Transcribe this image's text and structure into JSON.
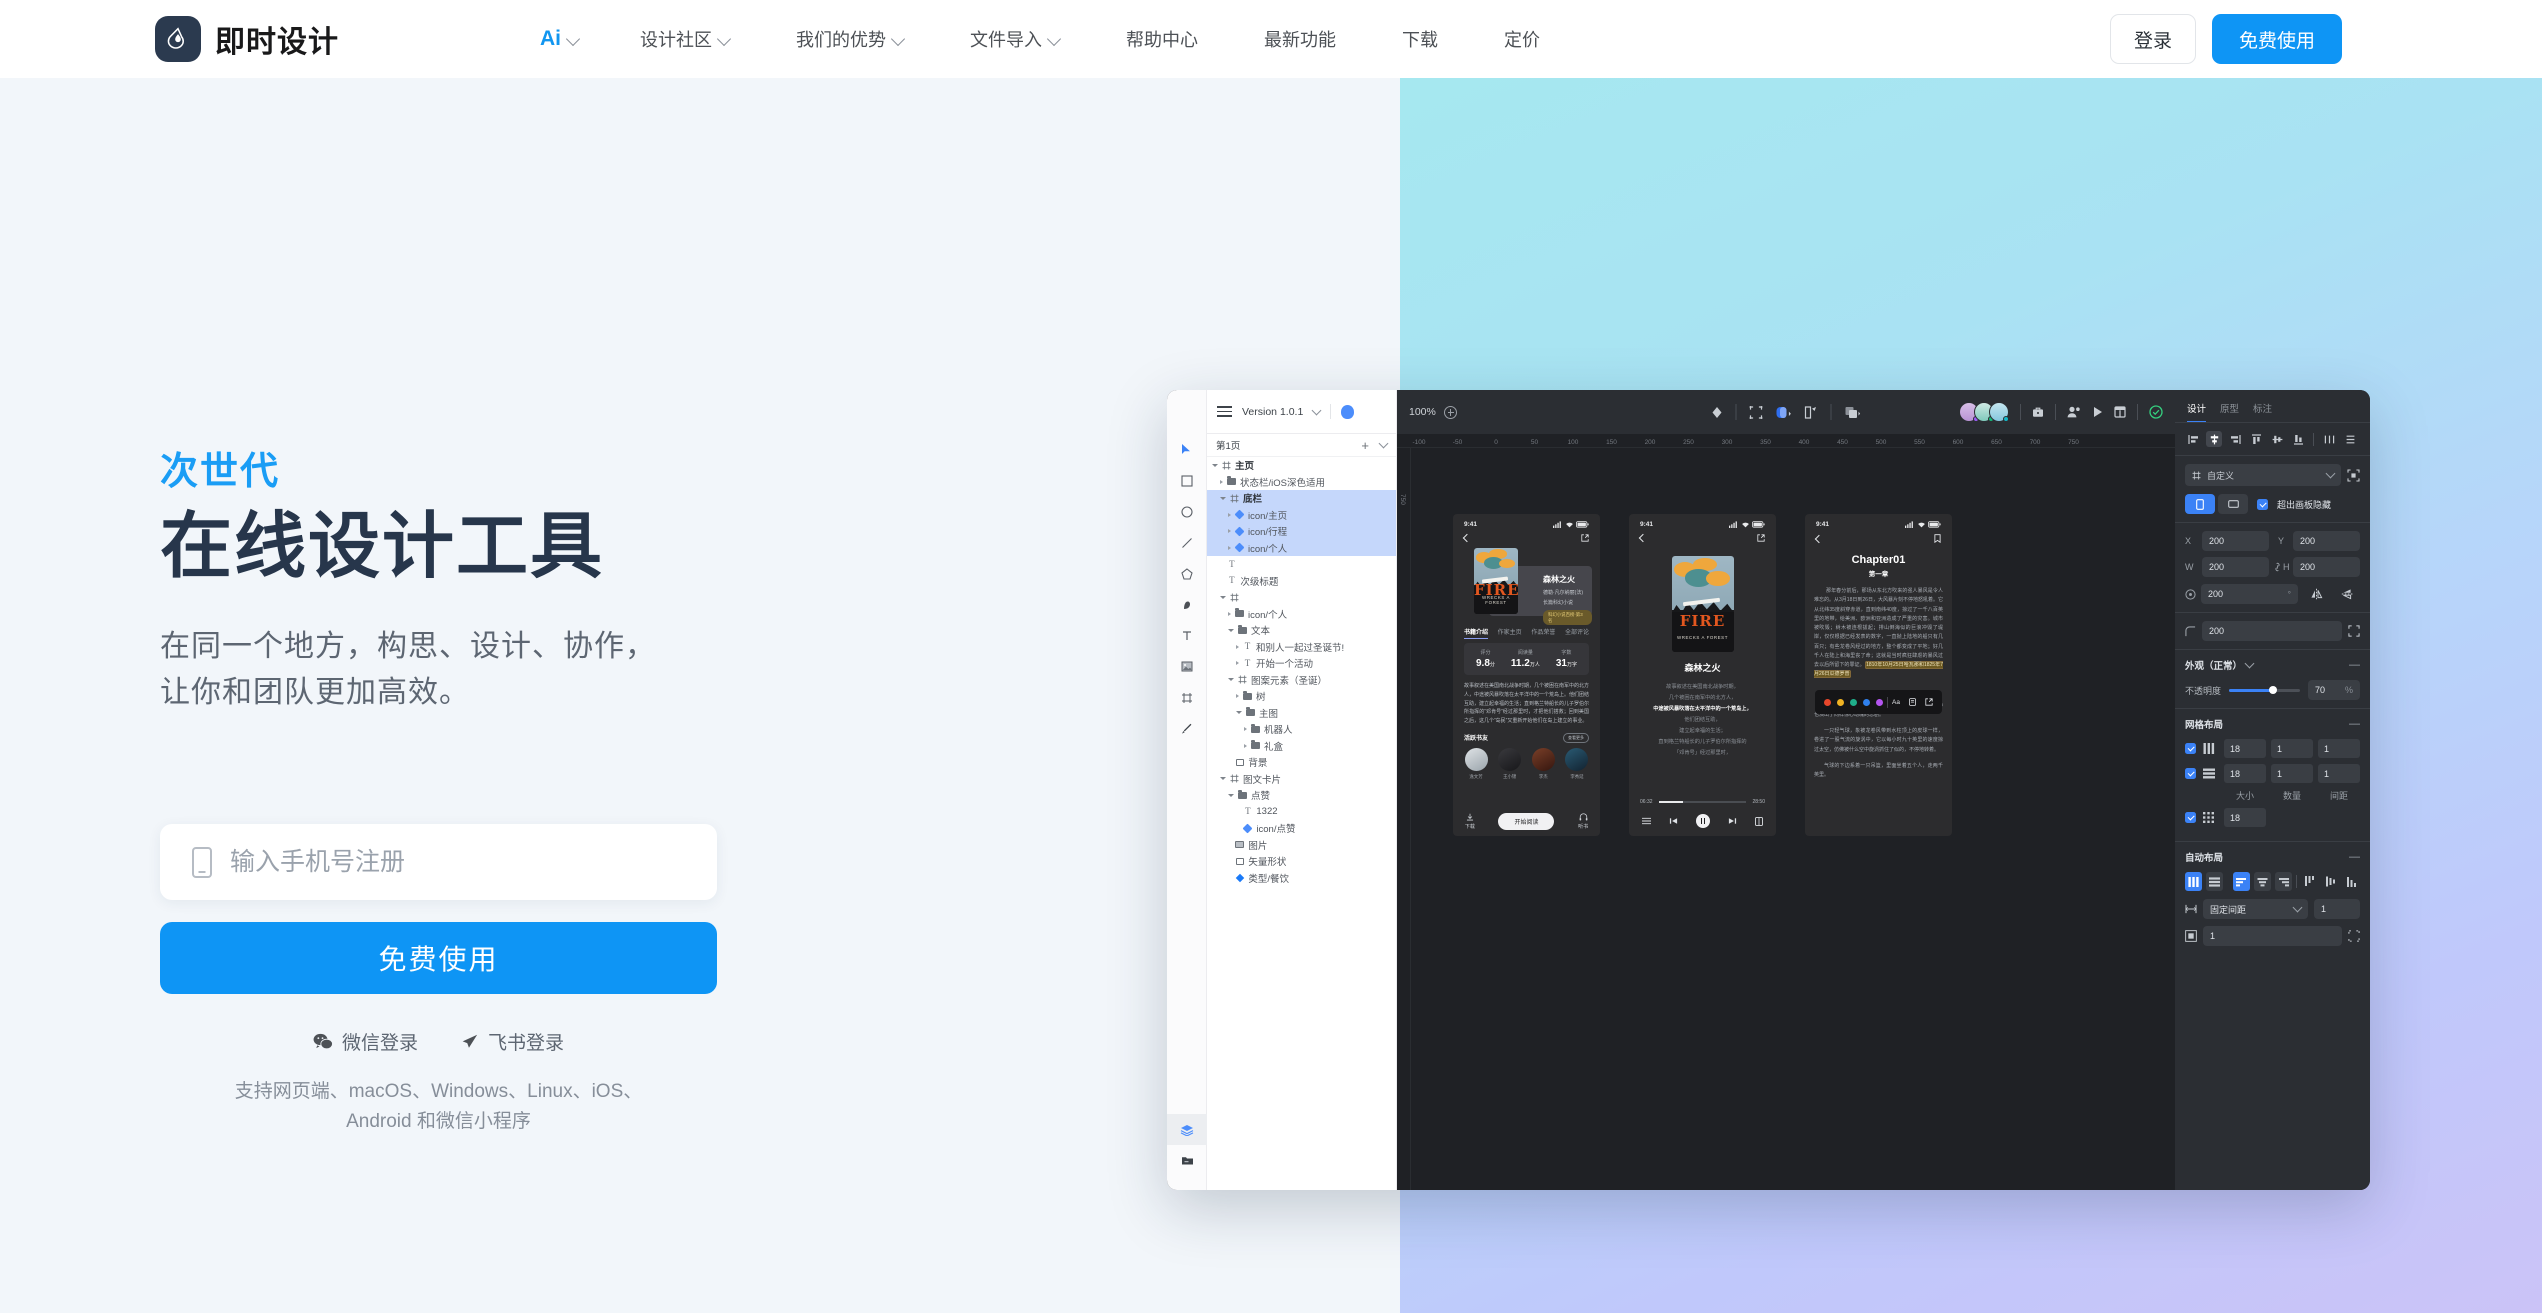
{
  "nav": {
    "brand": "即时设计",
    "brand_logo_icon": "droplet-logo-icon",
    "menu": [
      {
        "label": "Ai",
        "caret": true,
        "accent": true
      },
      {
        "label": "设计社区",
        "caret": true
      },
      {
        "label": "我们的优势",
        "caret": true
      },
      {
        "label": "文件导入",
        "caret": true
      },
      {
        "label": "帮助中心",
        "caret": false
      },
      {
        "label": "最新功能",
        "caret": false
      },
      {
        "label": "下载",
        "caret": false
      },
      {
        "label": "定价",
        "caret": false
      }
    ],
    "login_label": "登录",
    "free_label": "免费使用"
  },
  "hero": {
    "eyebrow": "次世代",
    "headline": "在线设计工具",
    "subhead_line1": "在同一个地方，构思、设计、协作，",
    "subhead_line2": "让你和团队更加高效。",
    "phone_placeholder": "输入手机号注册",
    "cta_label": "免费使用",
    "social": [
      {
        "label": "微信登录",
        "icon": "wechat-icon"
      },
      {
        "label": "飞书登录",
        "icon": "feishu-icon"
      }
    ],
    "support_line1": "支持网页端、macOS、Windows、Linux、iOS、",
    "support_line2": "Android 和微信小程序",
    "accent_color": "#0e95f5",
    "headline_color": "#27364b"
  },
  "app": {
    "titlebar": {
      "menu_icon": "hamburger-icon",
      "version": "Version 1.0.1",
      "avatar_icon": "user-avatar-icon"
    },
    "tools": [
      {
        "icon": "cursor-icon",
        "active": true
      },
      {
        "icon": "rectangle-icon"
      },
      {
        "icon": "ellipse-icon"
      },
      {
        "icon": "line-icon"
      },
      {
        "icon": "polygon-icon"
      },
      {
        "icon": "pen-icon"
      },
      {
        "icon": "text-icon"
      },
      {
        "icon": "image-icon"
      },
      {
        "icon": "frame-icon"
      },
      {
        "icon": "brush-icon"
      }
    ],
    "tools_bottom": [
      {
        "icon": "layers-icon",
        "selected": true
      },
      {
        "icon": "assets-folder-icon"
      }
    ],
    "layers": {
      "page_label": "第1页",
      "add_icon": "plus-icon",
      "collapse_icon": "chevron-down-icon",
      "tree": [
        {
          "label": "主页",
          "depth": 0,
          "icon": "frame-icon",
          "twist": "open",
          "bold": true
        },
        {
          "label": "状态栏/iOS深色适用",
          "depth": 1,
          "icon": "folder-icon",
          "twist": "closed"
        },
        {
          "label": "底栏",
          "depth": 1,
          "icon": "frame-icon",
          "twist": "open",
          "selected": true,
          "bold": true
        },
        {
          "label": "icon/主页",
          "depth": 2,
          "icon": "component-icon",
          "twist": "closed",
          "selected": true
        },
        {
          "label": "icon/行程",
          "depth": 2,
          "icon": "component-icon",
          "twist": "closed",
          "selected": true
        },
        {
          "label": "icon/个人",
          "depth": 2,
          "icon": "component-icon",
          "twist": "closed",
          "selected": true
        },
        {
          "label": "",
          "depth": 1,
          "icon": "text-icon",
          "twist": "none"
        },
        {
          "label": "次级标题",
          "depth": 1,
          "icon": "text-icon",
          "twist": "none"
        },
        {
          "label": "",
          "depth": 1,
          "icon": "frame-icon",
          "twist": "open"
        },
        {
          "label": "icon/个人",
          "depth": 2,
          "icon": "folder-icon",
          "twist": "closed"
        },
        {
          "label": "文本",
          "depth": 2,
          "icon": "folder-icon",
          "twist": "open"
        },
        {
          "label": "和别人一起过圣诞节!",
          "depth": 3,
          "icon": "text-icon",
          "twist": "closed"
        },
        {
          "label": "开始一个活动",
          "depth": 3,
          "icon": "text-icon",
          "twist": "closed"
        },
        {
          "label": "图案元素（圣诞）",
          "depth": 2,
          "icon": "frame-icon",
          "twist": "open"
        },
        {
          "label": "树",
          "depth": 3,
          "icon": "folder-icon",
          "twist": "closed"
        },
        {
          "label": "主图",
          "depth": 3,
          "icon": "folder-icon",
          "twist": "open"
        },
        {
          "label": "机器人",
          "depth": 4,
          "icon": "folder-icon",
          "twist": "closed"
        },
        {
          "label": "礼盒",
          "depth": 4,
          "icon": "folder-icon",
          "twist": "closed"
        },
        {
          "label": "背景",
          "depth": 2,
          "icon": "rect-icon",
          "twist": "none"
        },
        {
          "label": "图文卡片",
          "depth": 1,
          "icon": "frame-icon",
          "twist": "open"
        },
        {
          "label": "点赞",
          "depth": 2,
          "icon": "folder-icon",
          "twist": "open"
        },
        {
          "label": "1322",
          "depth": 3,
          "icon": "text-icon",
          "twist": "none"
        },
        {
          "label": "icon/点赞",
          "depth": 3,
          "icon": "component-icon",
          "twist": "none"
        },
        {
          "label": "图片",
          "depth": 2,
          "icon": "image-icon",
          "twist": "none"
        },
        {
          "label": "矢量形状",
          "depth": 2,
          "icon": "rect-icon",
          "twist": "none"
        },
        {
          "label": "类型/餐饮",
          "depth": 2,
          "icon": "instance-icon",
          "twist": "none"
        }
      ]
    },
    "toolbar": {
      "zoom": "100%",
      "zoom_plus_icon": "zoom-in-icon",
      "center_icons": [
        "diamond-icon",
        "scale-icon",
        "mask-icon",
        "component-split-icon",
        "boolean-icon"
      ],
      "right_icons": [
        "toolbox-icon",
        "invite-user-icon",
        "play-icon",
        "layout-icon",
        "check-circle-icon"
      ],
      "avatars": 3
    },
    "ruler": {
      "h_ticks": [
        "-100",
        "-50",
        "0",
        "50",
        "100",
        "150",
        "200",
        "250",
        "300",
        "350",
        "400",
        "450",
        "500",
        "550",
        "600",
        "650",
        "700",
        "750"
      ],
      "v_ticks": [
        "750"
      ]
    },
    "mockup1": {
      "time": "9:41",
      "back_icon": "chevron-left-icon",
      "share_icon": "share-icon",
      "title": "森林之火",
      "author": "德勒·凡尔纳丽(法)",
      "category": "长篇科幻小说",
      "badge": "科幻小说百榜·第3名",
      "cover_fire": "FIRE",
      "cover_sub": "WRECKS A FOREST",
      "tabs": [
        "书籍介绍",
        "作家主页",
        "作品荣誉",
        "全部评论"
      ],
      "stats": [
        {
          "label": "评分",
          "value": "9.8",
          "unit": "分"
        },
        {
          "label": "阅读量",
          "value": "11.2",
          "unit": "万人"
        },
        {
          "label": "字数",
          "value": "31",
          "unit": "万字"
        }
      ],
      "desc": "故事叙述在美国南北战争时期，几个被困在南军中的北方人，中途被风暴吹落在太平洋中的一个荒岛上。他们团结互助，建立起幸福的生活；直到格兰特船长的儿子罗伯尔所指挥的“邓肯号”经过那里时，才把他们搭救；回到美国之后，这几个“岛民”又重新开始他们在岛上建立的事业。",
      "friends_title": "活跃书友",
      "friends_more": "查看更多",
      "friends": [
        "逸文芳",
        "王小锦",
        "李杰",
        "李秀延"
      ],
      "bottom": [
        {
          "label": "下载",
          "icon": "download-icon"
        },
        {
          "label": "开始阅读",
          "icon": ""
        },
        {
          "label": "听书",
          "icon": "headphone-icon"
        }
      ]
    },
    "mockup2": {
      "time": "9:41",
      "title": "森林之火",
      "lines": [
        {
          "text": "故事叙述在美国南北战争时期，",
          "highlight": false
        },
        {
          "text": "几个被困在南军中的北方人，",
          "highlight": false
        },
        {
          "text": "中途被风暴吹落在太平洋中的一个荒岛上，",
          "highlight": true
        },
        {
          "text": "他们团结互助，",
          "highlight": false
        },
        {
          "text": "建立起幸福的生活；",
          "highlight": false
        },
        {
          "text": "直到格兰特船长的儿子罗伯尔所指挥的",
          "highlight": false
        },
        {
          "text": "「邓肯号」经过那里时，",
          "highlight": false
        }
      ],
      "time_elapsed": "06:32",
      "time_total": "28:50",
      "controls": [
        "list-icon",
        "prev-icon",
        "pause-icon",
        "next-icon",
        "book-icon"
      ]
    },
    "mockup3": {
      "time": "9:41",
      "back_icon": "chevron-left-icon",
      "bookmark_icon": "bookmark-icon",
      "chapter": "Chapter01",
      "chapter_cn": "第一章",
      "body_1": "那年春分前后，那场从东北方吹来的强人暴风是令人难忘的。从3月18日到26日，大风暴片刻不停地怒吼着。它从北纬35度斜穿赤道，直到南纬40度，掠过了一千八百英里的地带，给美洲、欧洲和亚洲造成了严重的灾害。城市被吹毁；树木被连根拔起；排山倒海似的巨浪冲毁了堤岸，仅仅根据已经发表的数字，一直抛上陆地的船只有几百只；有些龙卷风经过的地方，整个都变成了平地；好几千人在陆上和海里丧了命；这就是当时疯狂肆虐的暴风过去以后所留下的罪证。",
      "highlight_text": "1810年10月25日哈瓦那和1825年7月26日瓜德罗普",
      "body_2": "就在这陆地和海洋上惨遭浩劫的时候，激荡的高空中也演出了同样惊心动魄的悲剧。",
      "body_3": "一只轻气球，象被龙卷风带到水柱顶上的皮球一样，卷进了一股气流的旋涡中，它以每小时九十英里的速度掠过太空，仿佛被什么空中旋涡抓住了似的，不停地转着。",
      "body_4": "气球的下边系着一只吊篮，里面坐着五个人，走两千英里。",
      "ctx_swatches": [
        "#e8472b",
        "#f0b323",
        "#1fae8a",
        "#2f80ed",
        "#b455f0"
      ],
      "ctx_icons": [
        "text-size-icon",
        "note-icon",
        "share-icon"
      ]
    },
    "props": {
      "tabs": [
        {
          "label": "设计",
          "active": true
        },
        {
          "label": "原型",
          "active": false
        },
        {
          "label": "标注",
          "active": false
        }
      ],
      "align_icons": [
        "align-left-icon",
        "align-center-h-icon",
        "align-right-icon",
        "align-top-icon",
        "align-middle-v-icon",
        "align-bottom-icon",
        "distribute-h-icon",
        "distribute-v-icon"
      ],
      "constraint_label": "自定义",
      "constraint_icon": "frame-icon",
      "constraint_more_icon": "constraint-target-icon",
      "orientation_icons": [
        "portrait-icon",
        "landscape-icon"
      ],
      "clip_label": "超出画板隐藏",
      "clip_checked": true,
      "transform": {
        "x_label": "X",
        "x_value": "200",
        "y_label": "Y",
        "y_value": "200",
        "w_label": "W",
        "w_value": "200",
        "h_label": "H",
        "h_value": "200",
        "link_icon": "link-ratio-icon",
        "rotation_icon": "rotation-icon",
        "rotation_value": "200",
        "rotation_unit": "°",
        "flip_h_icon": "flip-horizontal-icon",
        "flip_v_icon": "flip-vertical-icon",
        "corner_icon": "corner-radius-icon",
        "corner_value": "200",
        "corner_expand_icon": "independent-corners-icon"
      },
      "appearance": {
        "title": "外观（正常）",
        "chevron_icon": "chevron-down-icon",
        "collapse_icon": "minus-icon",
        "opacity_label": "不透明度",
        "opacity_value": "70",
        "opacity_unit": "%"
      },
      "grid": {
        "title": "网格布局",
        "collapse_icon": "minus-icon",
        "rows": [
          {
            "icon": "columns-icon",
            "checked": true,
            "size": "18",
            "count": "1",
            "gutter": "1"
          },
          {
            "icon": "rows-icon",
            "checked": true,
            "size": "18",
            "count": "1",
            "gutter": "1"
          }
        ],
        "col_labels": [
          "大小",
          "数量",
          "间距"
        ],
        "square": {
          "icon": "grid-icon",
          "checked": true,
          "size": "18"
        }
      },
      "autolayout": {
        "title": "自动布局",
        "collapse_icon": "minus-icon",
        "dir_icons": [
          "horizontal-layout-icon",
          "vertical-layout-icon"
        ],
        "align_icons": [
          "align-start-icon",
          "align-center-icon",
          "align-end-icon",
          "space-top-icon",
          "space-mid-icon",
          "space-bottom-icon"
        ],
        "spacing_icon": "spacing-icon",
        "spacing_mode": "固定间距",
        "spacing_chevron": "chevron-down-icon",
        "spacing_value": "1",
        "padding_icon": "padding-icon",
        "padding_value": "1",
        "padding_more_icon": "padding-detail-icon"
      }
    }
  }
}
